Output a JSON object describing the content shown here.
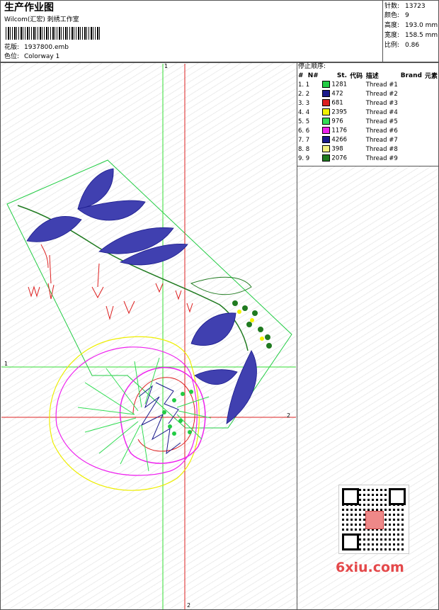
{
  "title": "生产作业图",
  "company": "Wilcom(汇宏) 刺绣工作室",
  "design_label": "花版:",
  "design_name": "1937800.emb",
  "colorway_label": "色位:",
  "colorway": "Colorway 1",
  "stats": [
    {
      "label": "针数:",
      "value": "13723"
    },
    {
      "label": "颜色:",
      "value": "9"
    },
    {
      "label": "高度:",
      "value": "193.0 mm"
    },
    {
      "label": "宽度:",
      "value": "158.5 mm"
    },
    {
      "label": "比例:",
      "value": "0.86"
    }
  ],
  "stop_title": "停止顺序:",
  "columns": {
    "num": "#",
    "n": "N#",
    "st": "St.",
    "code": "代码",
    "desc": "描述",
    "brand": "Brand",
    "elem": "元素"
  },
  "threads": [
    {
      "n": "1. 1",
      "color": "#22cc44",
      "st": "1281",
      "desc": "Thread #1"
    },
    {
      "n": "2. 2",
      "color": "#1a1a8c",
      "st": "472",
      "desc": "Thread #2"
    },
    {
      "n": "3. 3",
      "color": "#dd2020",
      "st": "681",
      "desc": "Thread #3"
    },
    {
      "n": "4. 4",
      "color": "#f2f200",
      "st": "2395",
      "desc": "Thread #4"
    },
    {
      "n": "5. 5",
      "color": "#33dd55",
      "st": "976",
      "desc": "Thread #5"
    },
    {
      "n": "6. 6",
      "color": "#ee22ee",
      "st": "1176",
      "desc": "Thread #6"
    },
    {
      "n": "7. 7",
      "color": "#1a1a8c",
      "st": "4266",
      "desc": "Thread #7"
    },
    {
      "n": "8. 8",
      "color": "#f2f080",
      "st": "398",
      "desc": "Thread #8"
    },
    {
      "n": "9. 9",
      "color": "#1f7a1f",
      "st": "2076",
      "desc": "Thread #9"
    }
  ],
  "axis_labels": {
    "top": "1",
    "left": "1",
    "right": "2",
    "bottom": "2"
  },
  "watermark": "6xiu.com"
}
